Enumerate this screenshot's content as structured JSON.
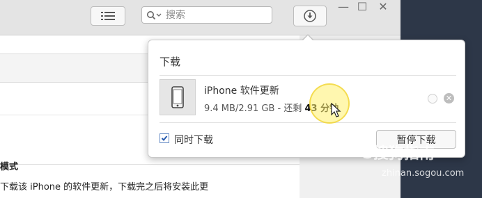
{
  "search": {
    "placeholder": "搜索"
  },
  "window_controls": {
    "minimize": "—",
    "maximize": "☐",
    "close": "✕"
  },
  "downloads_popover": {
    "title": "下载",
    "item": {
      "name": "iPhone 软件更新",
      "progress_prefix": "9.4 MB/2.91 GB - 还剩 ",
      "time_left": "43 分钟",
      "icon": "iphone-icon"
    },
    "simultaneous_checkbox": {
      "label": "同时下载",
      "checked": true
    },
    "pause_button": "暂停下载"
  },
  "background": {
    "section_heading": "模式",
    "description": "下载该 iPhone 的软件更新，下载完之后将安装此更"
  },
  "watermark": {
    "logo": "S搜狗指南",
    "url": "zhinan.sogou.com"
  },
  "colors": {
    "titlebar": "#e4e4e4",
    "checkbox_accent": "#2a5db0",
    "cursor_highlight": "#fff06e",
    "desktop": "#2d3748"
  }
}
